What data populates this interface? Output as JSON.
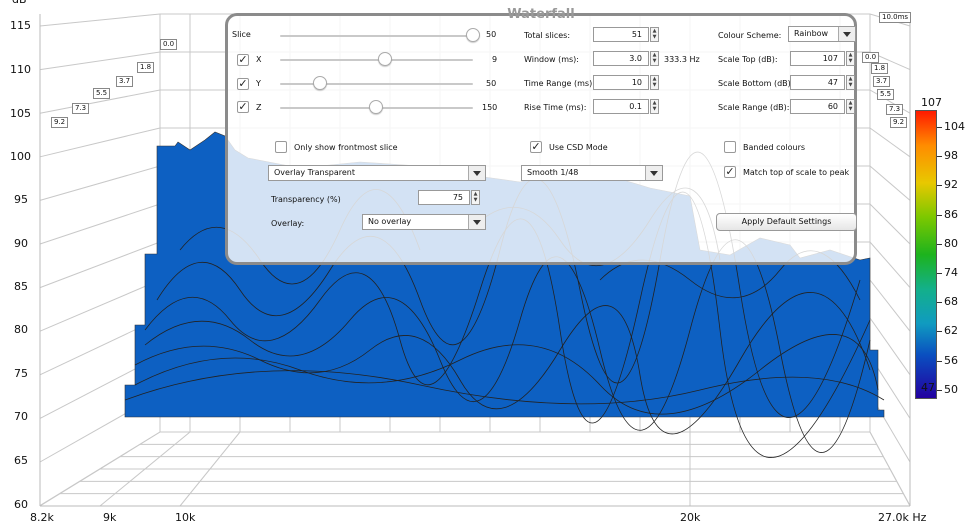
{
  "axes": {
    "y_unit": "dB",
    "y_ticks": [
      "115",
      "110",
      "105",
      "100",
      "95",
      "90",
      "85",
      "80",
      "75",
      "70",
      "65",
      "60"
    ],
    "x_ticks": [
      "8.2k",
      "9k",
      "10k",
      "20k",
      "27.0k Hz"
    ],
    "time_tags_left": [
      "0.0",
      "1.8",
      "3.7",
      "5.5",
      "7.3",
      "9.2"
    ],
    "time_tags_right": [
      "0.0",
      "1.8",
      "3.7",
      "5.5",
      "7.3",
      "9.2"
    ],
    "time_tag_top": "10.0ms"
  },
  "colorbar": {
    "top_label": "107",
    "bottom_label": "47",
    "ticks": [
      "104",
      "98",
      "92",
      "86",
      "80",
      "74",
      "68",
      "62",
      "56",
      "50"
    ]
  },
  "panel": {
    "title": "Waterfall",
    "slice": {
      "label": "Slice",
      "value": "50"
    },
    "x": {
      "label": "X",
      "value": "9",
      "checked": "✓"
    },
    "y": {
      "label": "Y",
      "value": "50",
      "checked": "✓"
    },
    "z": {
      "label": "Z",
      "value": "150",
      "checked": "✓"
    },
    "total_slices": {
      "label": "Total slices:",
      "value": "51"
    },
    "window": {
      "label": "Window (ms):",
      "value": "3.0",
      "extra": "333.3 Hz"
    },
    "time_range": {
      "label": "Time Range (ms):",
      "value": "10"
    },
    "rise_time": {
      "label": "Rise Time (ms):",
      "value": "0.1"
    },
    "colour_scheme": {
      "label": "Colour Scheme:",
      "value": "Rainbow"
    },
    "scale_top": {
      "label": "Scale Top (dB):",
      "value": "107"
    },
    "scale_bottom": {
      "label": "Scale Bottom (dB):",
      "value": "47"
    },
    "scale_range": {
      "label": "Scale Range (dB):",
      "value": "60"
    },
    "only_front": {
      "label": "Only show frontmost slice"
    },
    "use_csd": {
      "label": "Use CSD Mode",
      "checked": "✓"
    },
    "banded": {
      "label": "Banded colours"
    },
    "match_top": {
      "label": "Match top of scale to peak",
      "checked": "✓"
    },
    "overlay_mode": "Overlay Transparent",
    "smoothing": "Smooth 1/48",
    "transparency": {
      "label": "Transparency (%)",
      "value": "75"
    },
    "overlay": {
      "label": "Overlay:",
      "value": "No overlay"
    },
    "apply_button": "Apply Default Settings"
  }
}
